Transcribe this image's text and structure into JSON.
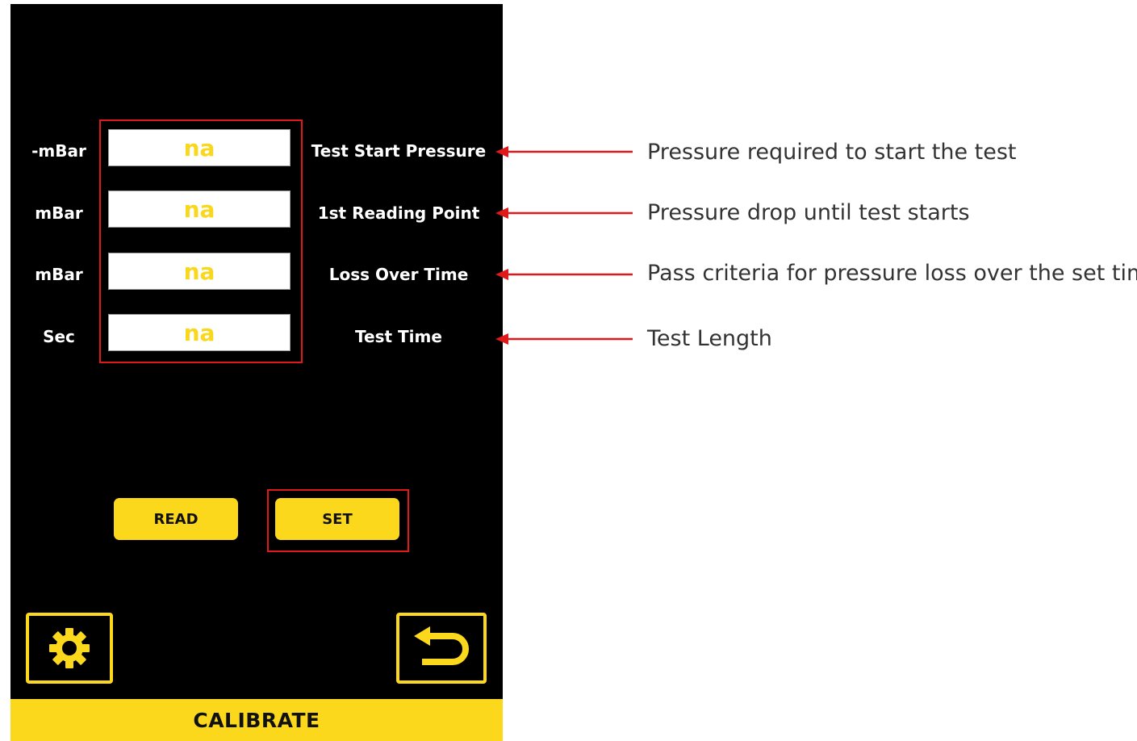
{
  "settings": [
    {
      "unit": "-mBar",
      "value": "na",
      "label": "Test Start Pressure",
      "annotation": "Pressure required to start the test"
    },
    {
      "unit": "mBar",
      "value": "na",
      "label": "1st Reading Point",
      "annotation": "Pressure drop until test starts"
    },
    {
      "unit": "mBar",
      "value": "na",
      "label": "Loss Over Time",
      "annotation": "Pass criteria for pressure loss over the set time"
    },
    {
      "unit": "Sec",
      "value": "na",
      "label": "Test Time",
      "annotation": "Test Length"
    }
  ],
  "buttons": {
    "read_label": "READ",
    "set_label": "SET"
  },
  "icons": {
    "settings": "gear-icon",
    "back": "back-arrow-icon"
  },
  "footer": {
    "title": "CALIBRATE"
  },
  "colors": {
    "screen_bg": "#000000",
    "accent_yellow": "#fcd81c",
    "value_text": "#f9d71c",
    "highlight_red": "#e0191b",
    "annotation_text": "#333333"
  }
}
